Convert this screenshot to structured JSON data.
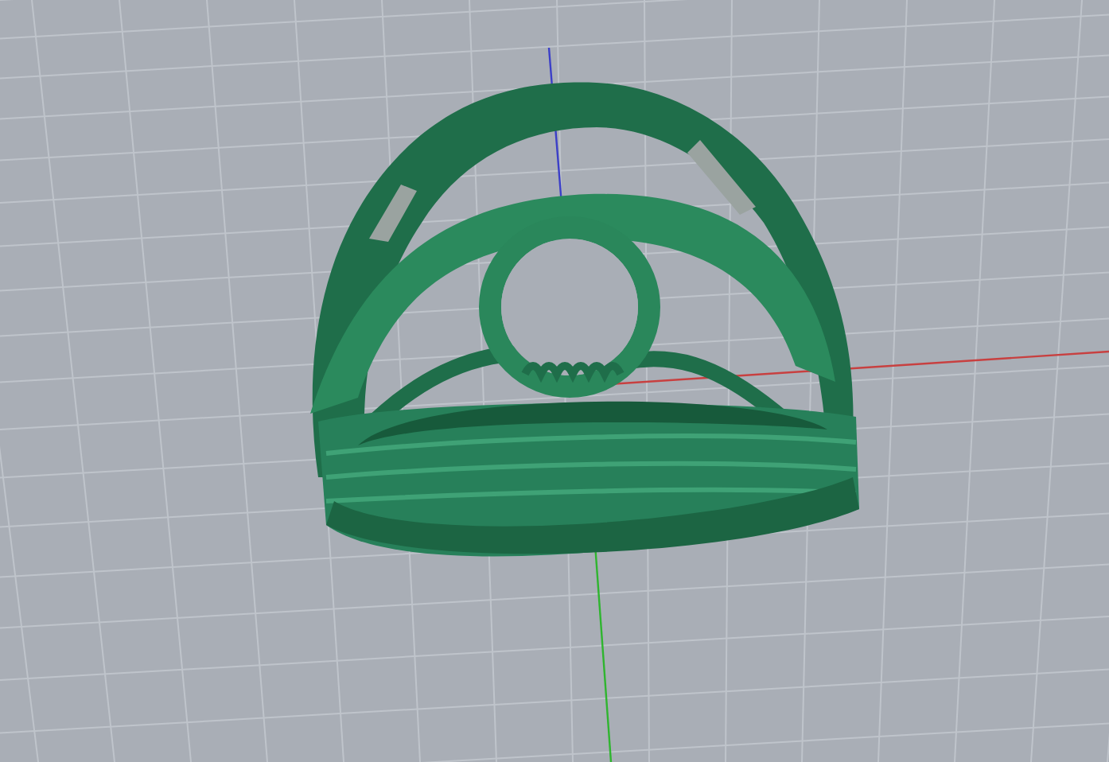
{
  "viewport": {
    "grid": true,
    "axes": true,
    "model": {
      "kind": "ring"
    }
  }
}
